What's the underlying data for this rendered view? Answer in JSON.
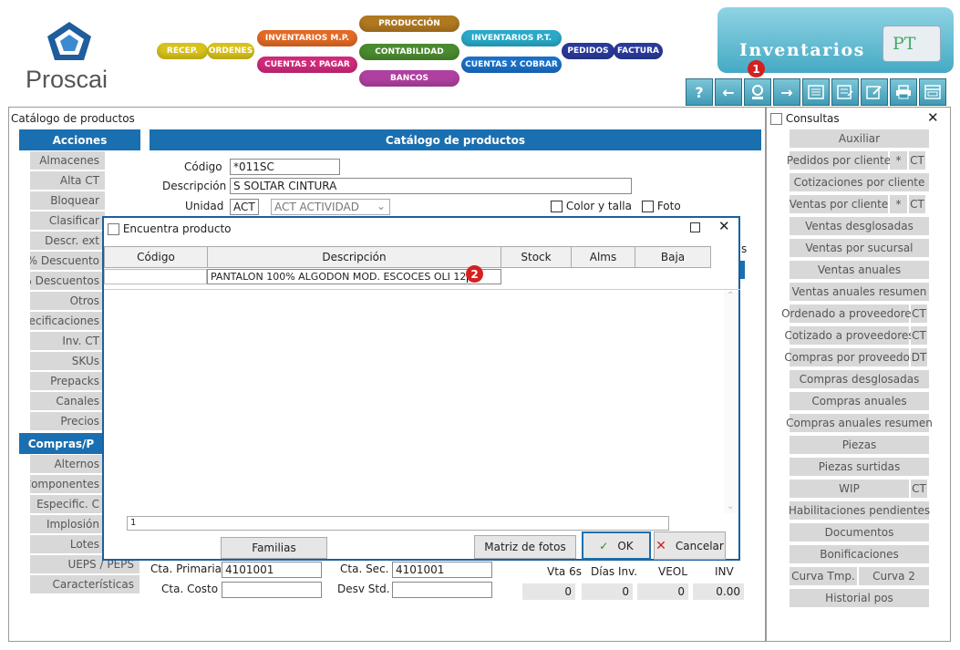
{
  "brand": {
    "name": "Proscai"
  },
  "modules": {
    "recep": "RECEP.",
    "ordenes": "ORDENES",
    "inv_mp": "INVENTARIOS M.P.",
    "cuentas_pagar": "CUENTAS X PAGAR",
    "produccion": "PRODUCCIÓN",
    "contabilidad": "CONTABILIDAD",
    "bancos": "BANCOS",
    "inv_pt": "INVENTARIOS P.T.",
    "cuentas_cobrar": "CUENTAS X COBRAR",
    "pedidos": "PEDIDOS",
    "factura": "FACTURA"
  },
  "banner": {
    "title": "Inventarios",
    "tag": "PT"
  },
  "toolbar": {
    "help": "?",
    "back": "←",
    "search": "search",
    "forward": "→",
    "list": "list",
    "report": "report",
    "edit": "edit",
    "print": "print",
    "window": "window"
  },
  "badges": {
    "one": "1",
    "two": "2"
  },
  "window": {
    "title": "Catálogo de productos"
  },
  "acciones": {
    "header": "Acciones",
    "items": [
      "Almacenes",
      "Alta CT",
      "Bloquear",
      "Clasificar",
      "Descr. ext",
      "% Descuento",
      "% Descuentos",
      "Otros",
      "Especificaciones",
      "Inv. CT",
      "SKUs",
      "Prepacks",
      "Canales",
      "Precios"
    ]
  },
  "compras": {
    "header": "Compras/P",
    "items": [
      "Alternos",
      "Componentes",
      "Especific. C",
      "Implosión",
      "Lotes",
      "UEPS / PEPS",
      "Características"
    ]
  },
  "form": {
    "header": "Catálogo de productos",
    "codigo_label": "Código",
    "codigo": "*011SC",
    "descripcion_label": "Descripción",
    "descripcion": "S SOLTAR CINTURA",
    "unidad_label": "Unidad",
    "unidad": "ACT",
    "unidad_desc": "ACT ACTIVIDAD",
    "color_talla": "Color y talla",
    "foto": "Foto",
    "cta_primaria_label": "Cta. Primaria",
    "cta_primaria": "4101001",
    "cta_sec_label": "Cta. Sec.",
    "cta_sec": "4101001",
    "cta_costo_label": "Cta. Costo",
    "desv_std_label": "Desv Std.",
    "stats": [
      {
        "label": "Vta 6s",
        "value": "0"
      },
      {
        "label": "Días Inv.",
        "value": "0"
      },
      {
        "label": "VEOL",
        "value": "0"
      },
      {
        "label": "INV",
        "value": "0.00"
      }
    ],
    "hidden_s": "s"
  },
  "dialog": {
    "title": "Encuentra producto",
    "columns": [
      "Código",
      "Descripción",
      "Stock",
      "Alms",
      "Baja"
    ],
    "search_desc": "PANTALON 100%  ALGODON MOD. ESCOCES OLI 12",
    "count": "1",
    "familias": "Familias",
    "matriz": "Matriz de fotos",
    "ok": "OK",
    "cancel": "Cancelar"
  },
  "consultas": {
    "title": "Consultas",
    "items": [
      {
        "label": "Auxiliar"
      },
      {
        "label": "Pedidos por cliente",
        "extra": [
          "*",
          "CT"
        ]
      },
      {
        "label": "Cotizaciones por cliente"
      },
      {
        "label": "Ventas por cliente",
        "extra": [
          "*",
          "CT"
        ]
      },
      {
        "label": "Ventas desglosadas"
      },
      {
        "label": "Ventas por sucursal"
      },
      {
        "label": "Ventas anuales"
      },
      {
        "label": "Ventas anuales resumen"
      },
      {
        "label": "Ordenado a proveedores",
        "extra": [
          "CT"
        ]
      },
      {
        "label": "Cotizado a proveedores",
        "extra": [
          "CT"
        ]
      },
      {
        "label": "Compras por proveedor",
        "extra": [
          "DT"
        ]
      },
      {
        "label": "Compras desglosadas"
      },
      {
        "label": "Compras anuales"
      },
      {
        "label": "Compras anuales resumen"
      },
      {
        "label": "Piezas"
      },
      {
        "label": "Piezas surtidas"
      },
      {
        "label": "WIP",
        "extra": [
          "CT"
        ]
      },
      {
        "label": "Habilitaciones pendientes"
      },
      {
        "label": "Documentos"
      },
      {
        "label": "Bonificaciones"
      },
      {
        "label": "Curva Tmp.",
        "extra": [
          "Curva 2"
        ]
      },
      {
        "label": "Historial pos"
      }
    ]
  },
  "colors": {
    "accent": "#1a6fb0",
    "banner": "#45aac4",
    "badge": "#d42020"
  }
}
